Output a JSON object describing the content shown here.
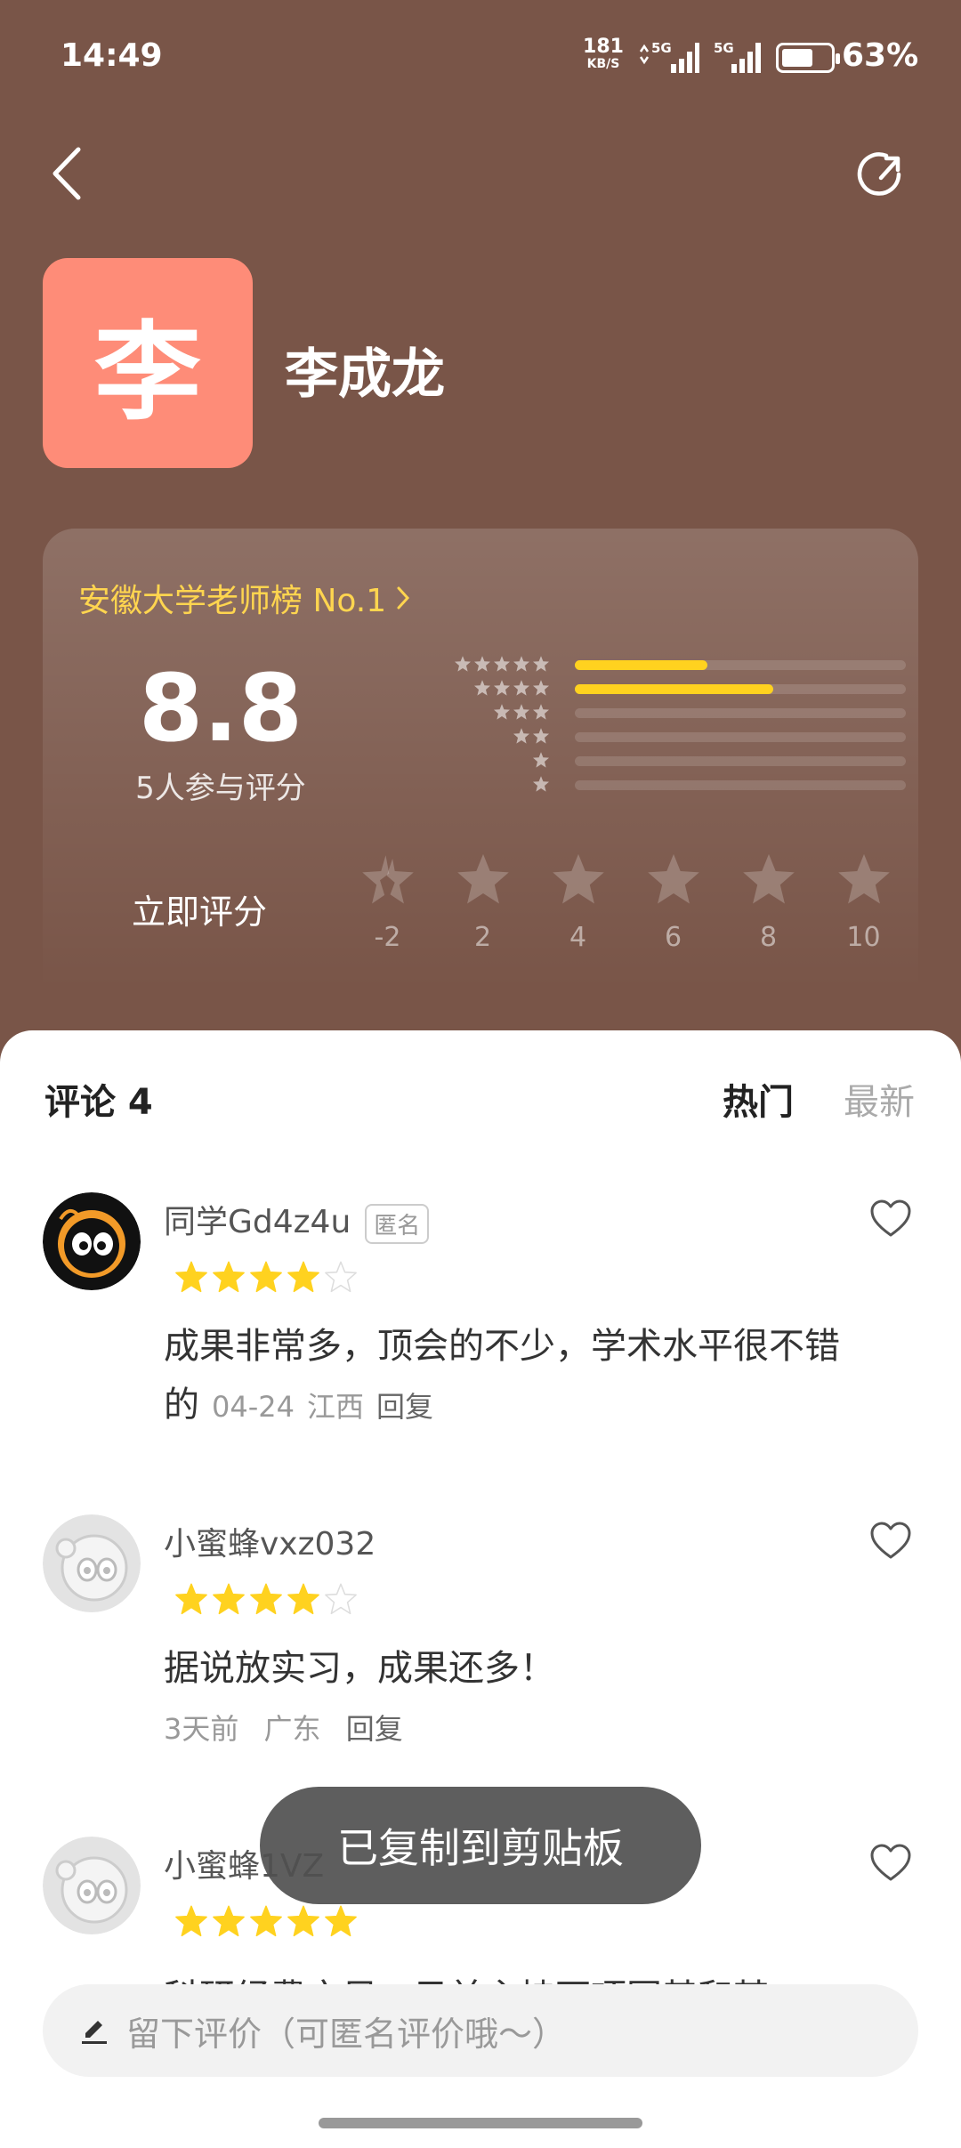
{
  "status_bar": {
    "time": "14:49",
    "net_speed_value": "181",
    "net_speed_unit": "KB/S",
    "sim1_label": "5G",
    "sim2_label": "5G",
    "battery_percent": "63%"
  },
  "header": {
    "avatar_char": "李",
    "teacher_name": "李成龙",
    "back_icon": "chevron-left-icon",
    "share_icon": "share-icon"
  },
  "rating": {
    "rank_text": "安徽大学老师榜 No.1",
    "score": "8.8",
    "rater_count_text": "5人参与评分",
    "distribution": [
      {
        "stars": 5,
        "fraction": 0.4
      },
      {
        "stars": 4,
        "fraction": 0.6
      },
      {
        "stars": 3,
        "fraction": 0
      },
      {
        "stars": 2,
        "fraction": 0
      },
      {
        "stars": 1,
        "fraction": 0
      },
      {
        "stars": 0.5,
        "fraction": 0
      }
    ],
    "rate_now_label": "立即评分",
    "rate_options": [
      "-2",
      "2",
      "4",
      "6",
      "8",
      "10"
    ]
  },
  "comments": {
    "title": "评论 4",
    "sort_hot": "热门",
    "sort_new": "最新",
    "items": [
      {
        "name": "同学Gd4z4u",
        "badge": "匿名",
        "stars": 4,
        "text": "成果非常多，顶会的不少，学术水平很不错的",
        "date": "04-24",
        "location": "江西",
        "reply": "回复"
      },
      {
        "name": "小蜜蜂vxz032",
        "stars": 4,
        "text": "据说放实习，成果还多！",
        "date": "3天前",
        "location": "广东",
        "reply": "回复"
      },
      {
        "name": "小蜜蜂1VZ",
        "stars": 5,
        "text": "科研经费充足，目前主持两项国基和某"
      }
    ]
  },
  "toast": "已复制到剪贴板",
  "input": {
    "placeholder": "留下评价（可匿名评价哦～）"
  },
  "colors": {
    "header_bg": "#795548",
    "avatar_bg": "#fe8c78",
    "accent_yellow": "#ffd21f",
    "rank_text": "#ffd54f"
  }
}
